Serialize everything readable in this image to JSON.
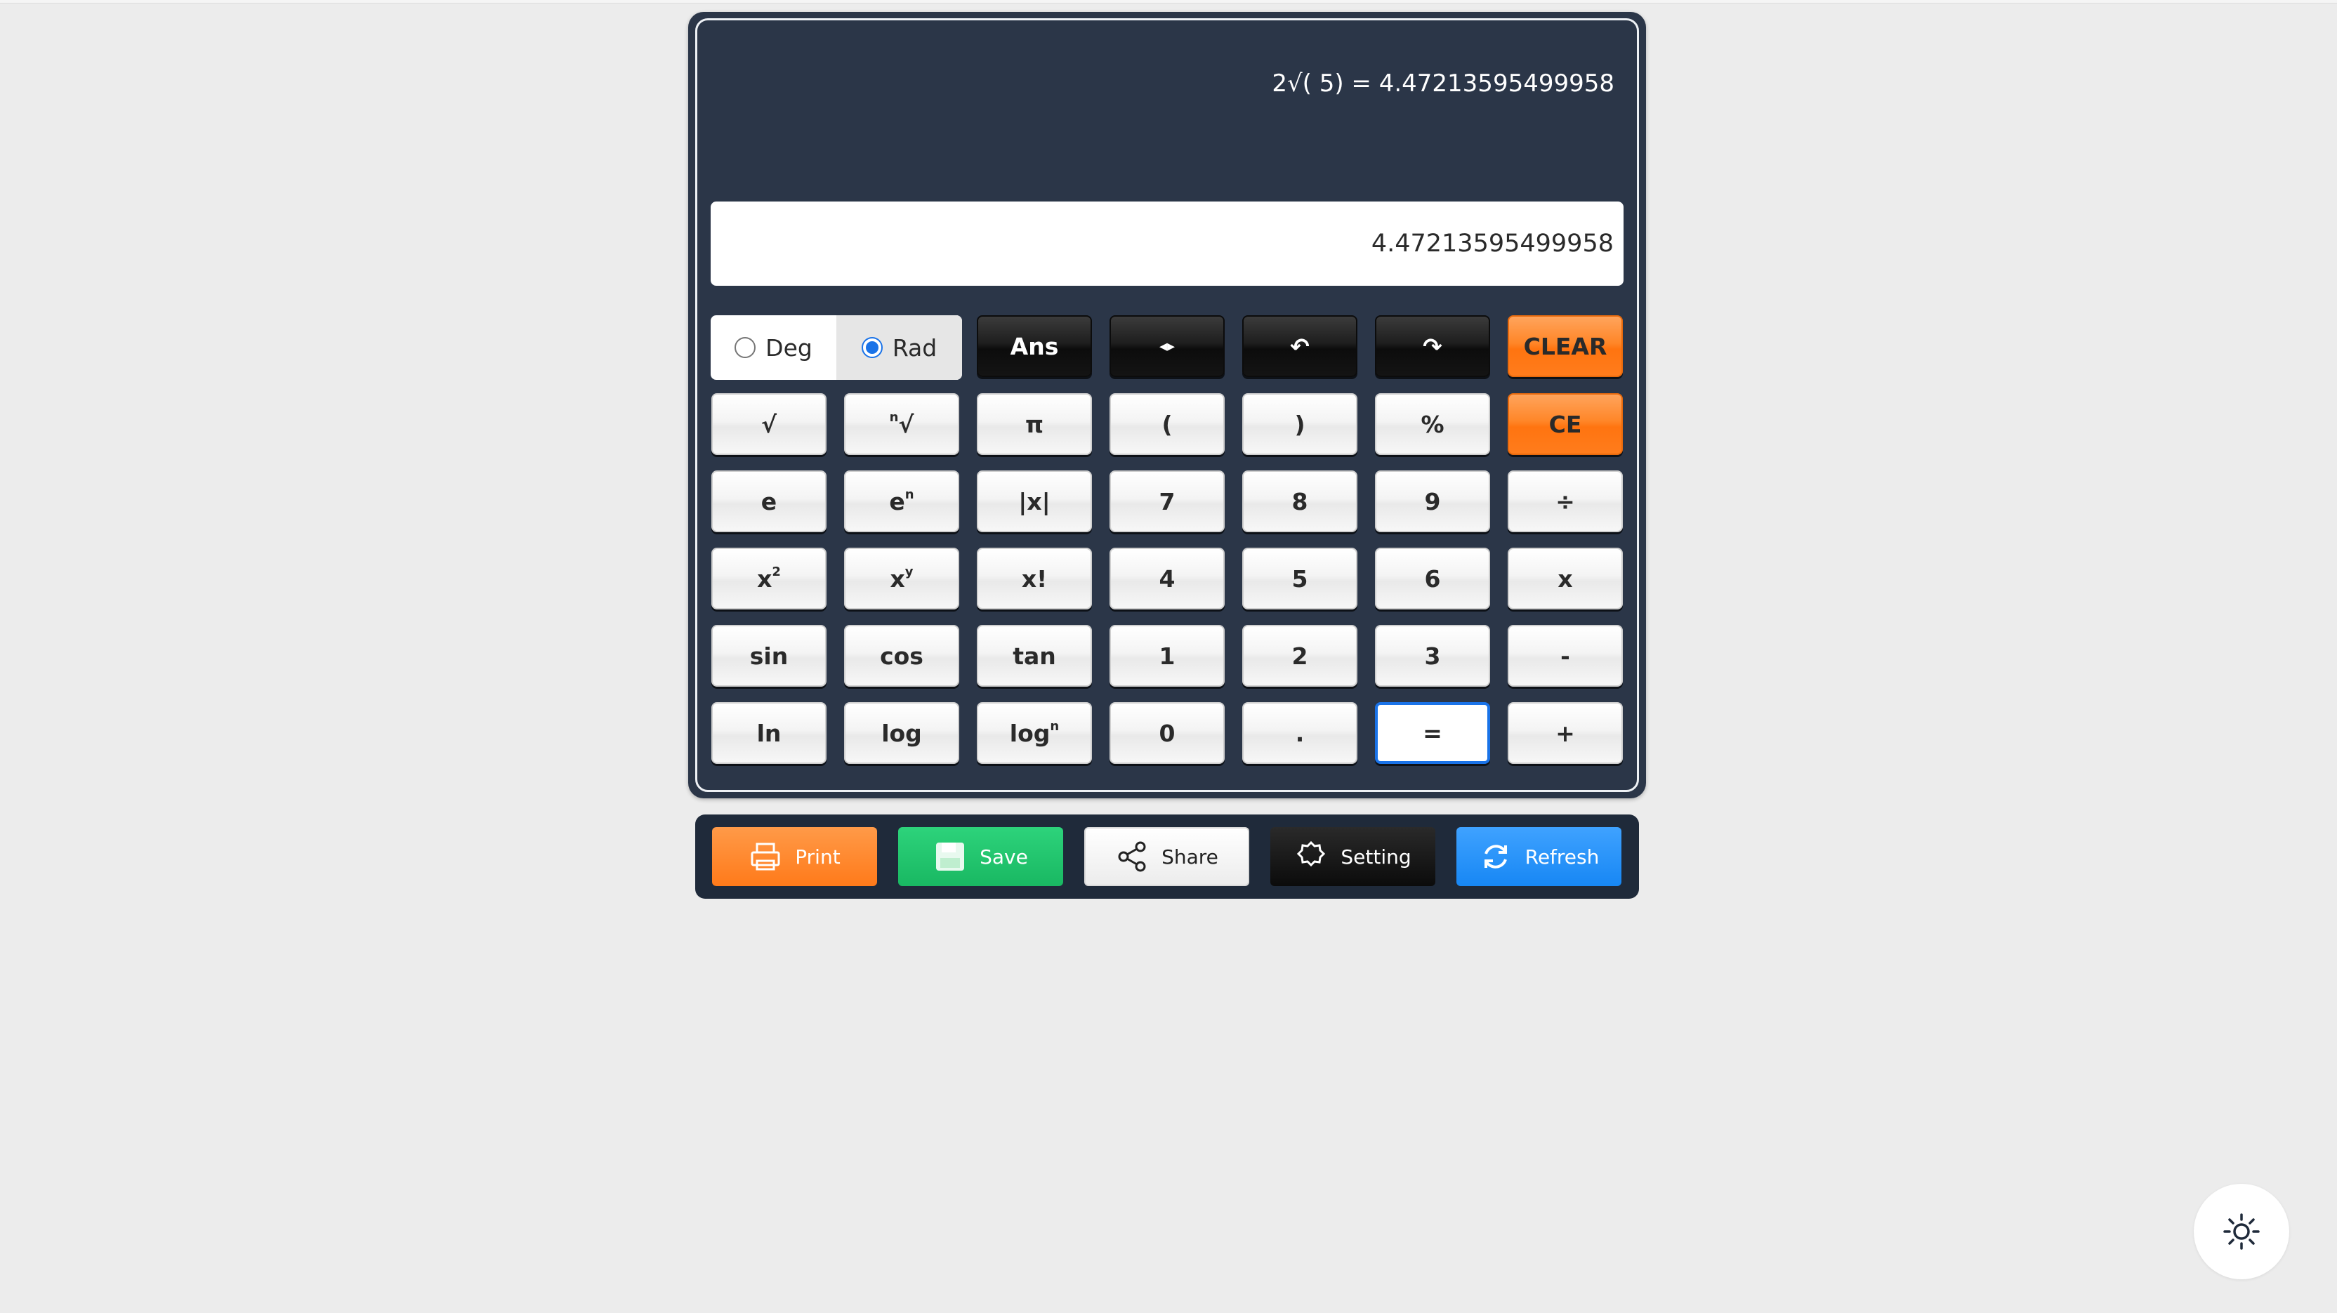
{
  "history": "2√( 5) = 4.47213595499958",
  "display": {
    "value": "4.47213595499958"
  },
  "angle_mode": {
    "options": [
      {
        "label": "Deg",
        "checked": false
      },
      {
        "label": "Rad",
        "checked": true
      }
    ]
  },
  "top_keys": {
    "ans": "Ans",
    "cursor": "◂▸",
    "undo": "↶",
    "redo": "↷",
    "clear": "CLEAR"
  },
  "keys": {
    "sqrt": "√",
    "nroot_prefix": "n",
    "nroot": "√",
    "pi": "π",
    "lparen": "(",
    "rparen": ")",
    "percent": "%",
    "ce": "CE",
    "e": "e",
    "en_base": "e",
    "en_sup": "n",
    "abs": "|x|",
    "seven": "7",
    "eight": "8",
    "nine": "9",
    "divide": "÷",
    "x2_base": "x",
    "x2_sup": "2",
    "xy_base": "x",
    "xy_sup": "y",
    "fact": "x!",
    "four": "4",
    "five": "5",
    "six": "6",
    "multiply": "x",
    "sin": "sin",
    "cos": "cos",
    "tan": "tan",
    "one": "1",
    "two": "2",
    "three": "3",
    "minus": "-",
    "ln": "ln",
    "log": "log",
    "logn_base": "log",
    "logn_sup": "n",
    "zero": "0",
    "dot": ".",
    "equals": "=",
    "plus": "+"
  },
  "toolbar": {
    "print": "Print",
    "save": "Save",
    "share": "Share",
    "setting": "Setting",
    "refresh": "Refresh"
  },
  "colors": {
    "frame": "#2b3648",
    "orange": "#ff7f1f",
    "green": "#1fc36c",
    "blue": "#1f8cf6",
    "focus": "#1a73e8"
  },
  "icons": [
    "printer-icon",
    "floppy-disk-icon",
    "share-icon",
    "gear-icon",
    "refresh-icon",
    "sun-icon"
  ]
}
